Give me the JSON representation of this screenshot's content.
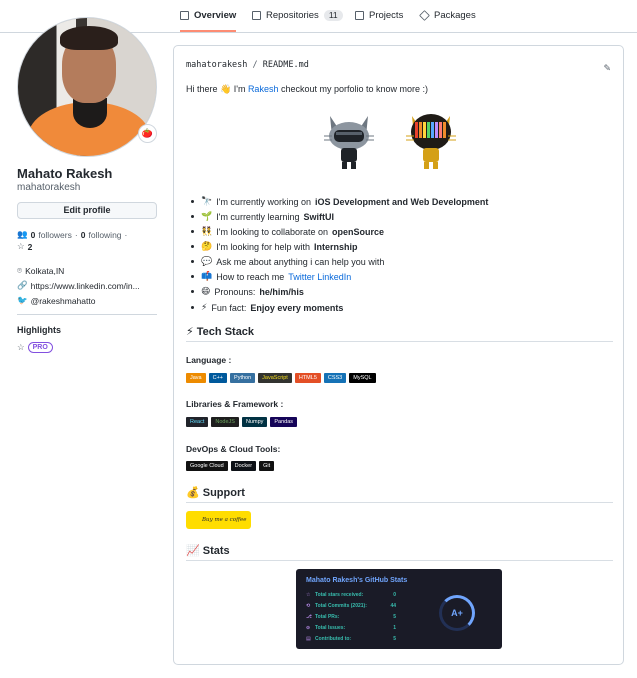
{
  "tabs": [
    {
      "label": "Overview"
    },
    {
      "label": "Repositories",
      "count": "11"
    },
    {
      "label": "Projects"
    },
    {
      "label": "Packages"
    }
  ],
  "profile": {
    "avatar_badge": "🍅",
    "name": "Mahato Rakesh",
    "login": "mahatorakesh",
    "edit_label": "Edit profile",
    "followers_count": "0",
    "followers_label": "followers",
    "following_count": "0",
    "following_label": "following",
    "stars_count": "2",
    "location": "Kolkata,IN",
    "website": "https://www.linkedin.com/in...",
    "twitter": "@rakeshmahatto",
    "highlights_title": "Highlights",
    "pro_label": "PRO"
  },
  "readme": {
    "owner": "mahatorakesh",
    "file": "README.md",
    "intro_pre": "Hi there 👋 I'm ",
    "intro_link": "Rakesh",
    "intro_post": " checkout my porfolio to know more :)",
    "list": [
      {
        "emoji": "🔭",
        "pre": "I'm currently working on ",
        "bold": "iOS Development and Web Development"
      },
      {
        "emoji": "🌱",
        "pre": "I'm currently learning ",
        "bold": "SwiftUI"
      },
      {
        "emoji": "👯",
        "pre": "I'm looking to collaborate on ",
        "bold": "openSource"
      },
      {
        "emoji": "🤔",
        "pre": "I'm looking for help with ",
        "bold": "Internship"
      },
      {
        "emoji": "💬",
        "pre": "Ask me about anything i can help you with",
        "bold": ""
      },
      {
        "emoji": "📫",
        "pre": "How to reach me ",
        "link": "Twitter LinkedIn"
      },
      {
        "emoji": "😄",
        "pre": "Pronouns: ",
        "bold": "he/him/his"
      },
      {
        "emoji": "⚡",
        "pre": "Fun fact: ",
        "bold": "Enjoy every moments"
      }
    ],
    "tech_title": "⚡ Tech Stack",
    "language_title": "Language :",
    "languages": [
      {
        "label": "Java",
        "color": "#ed8b00"
      },
      {
        "label": "C++",
        "color": "#00599c"
      },
      {
        "label": "Python",
        "color": "#3670a0"
      },
      {
        "label": "JavaScript",
        "color": "#323330"
      },
      {
        "label": "HTML5",
        "color": "#e34f26"
      },
      {
        "label": "CSS3",
        "color": "#1572b6"
      },
      {
        "label": "MySQL",
        "color": "#000000"
      }
    ],
    "frameworks_title": "Libraries & Framework :",
    "frameworks": [
      {
        "label": "React",
        "color": "#20232a"
      },
      {
        "label": "NodeJS",
        "color": "#1e1e1e"
      },
      {
        "label": "Numpy",
        "color": "#013243"
      },
      {
        "label": "Pandas",
        "color": "#150458"
      }
    ],
    "devops_title": "DevOps & Cloud Tools:",
    "devops": [
      {
        "label": "Google Cloud",
        "color": "#111111"
      },
      {
        "label": "Docker",
        "color": "#0d1117"
      },
      {
        "label": "Git",
        "color": "#111111"
      }
    ],
    "support_title": "💰 Support",
    "coffee_label": "Buy me a coffee",
    "stats_title": "📈 Stats"
  },
  "stats": {
    "title": "Mahato Rakesh's GitHub Stats",
    "rows": [
      {
        "label": "Total stars received:",
        "value": "0"
      },
      {
        "label": "Total Commits (2021):",
        "value": "44"
      },
      {
        "label": "Total PRs:",
        "value": "5"
      },
      {
        "label": "Total Issues:",
        "value": "1"
      },
      {
        "label": "Contributed to:",
        "value": "5"
      }
    ],
    "grade": "A+"
  }
}
